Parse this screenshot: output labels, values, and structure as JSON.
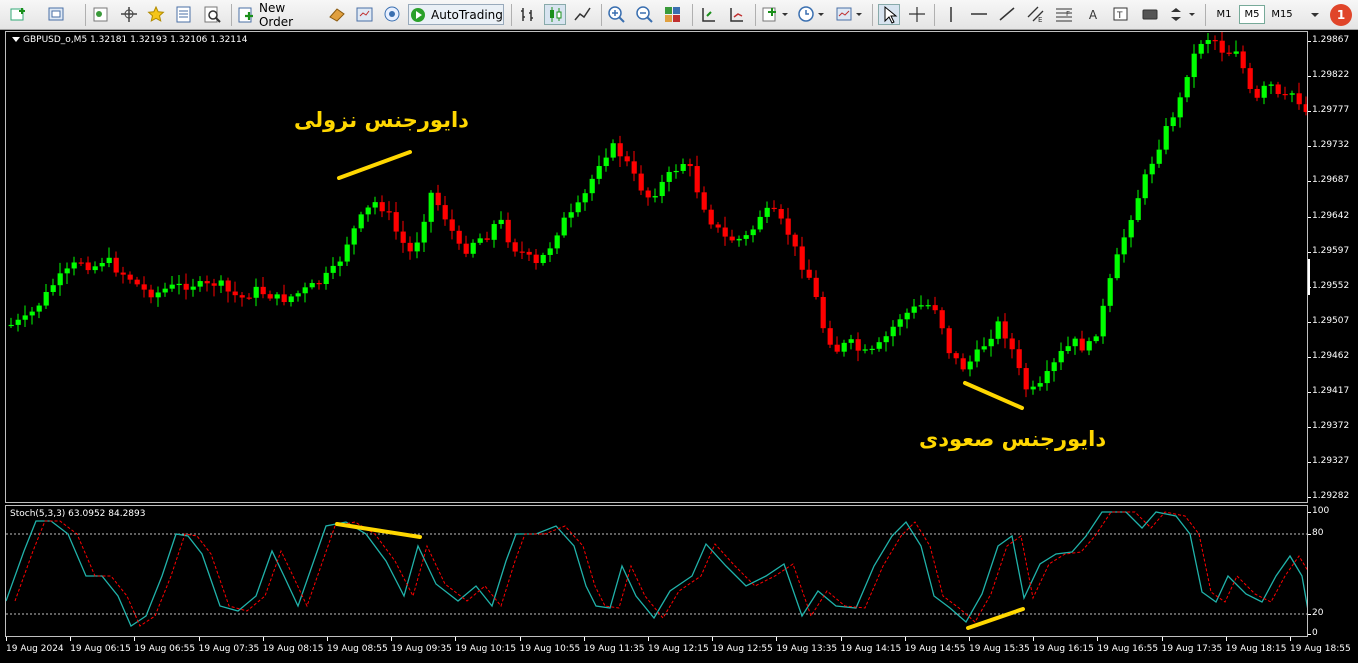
{
  "toolbar": {
    "new_order_label": "New Order",
    "autotrading_label": "AutoTrading",
    "timeframes": [
      "M1",
      "M5",
      "M15"
    ],
    "active_timeframe": "M5",
    "notification_count": "1"
  },
  "chart": {
    "title": "GBPUSD_o,M5  1.32181 1.32193 1.32106 1.32114",
    "price_ticks": [
      "1.29867",
      "1.29822",
      "1.29777",
      "1.29732",
      "1.29687",
      "1.29642",
      "1.29597",
      "1.29552",
      "1.29507",
      "1.29462",
      "1.29417",
      "1.29372",
      "1.29327",
      "1.29282"
    ],
    "bear_divergence_label": "دایورجنس نزولی",
    "bull_divergence_label": "دایورجنس صعودی",
    "up_color": "#00ff00",
    "down_color": "#ff0000",
    "annotation_color": "#ffd700"
  },
  "stochastic": {
    "title": "Stoch(5,3,3) 63.0952 84.2893",
    "levels": [
      "100",
      "80",
      "20",
      "0"
    ],
    "main_color": "#20b2aa",
    "signal_color": "#ff0000"
  },
  "time_axis": [
    "19 Aug 2024",
    "19 Aug 06:15",
    "19 Aug 06:55",
    "19 Aug 07:35",
    "19 Aug 08:15",
    "19 Aug 08:55",
    "19 Aug 09:35",
    "19 Aug 10:15",
    "19 Aug 10:55",
    "19 Aug 11:35",
    "19 Aug 12:15",
    "19 Aug 12:55",
    "19 Aug 13:35",
    "19 Aug 14:15",
    "19 Aug 14:55",
    "19 Aug 15:35",
    "19 Aug 16:15",
    "19 Aug 16:55",
    "19 Aug 17:35",
    "19 Aug 18:15",
    "19 Aug 18:55"
  ]
}
